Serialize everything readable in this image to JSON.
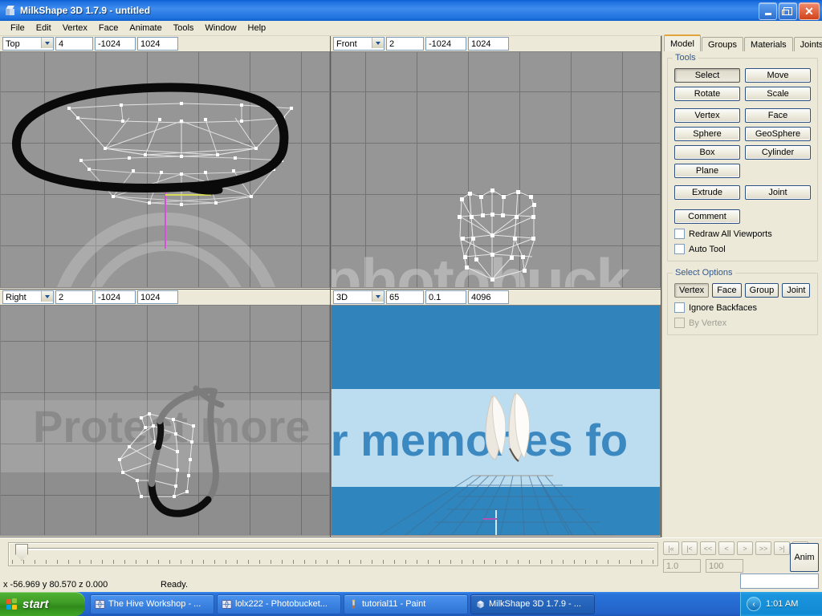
{
  "window": {
    "title": "MilkShape 3D 1.7.9 - untitled",
    "icon": "cube-icon",
    "controls": {
      "minimize": "_",
      "maximize": "□",
      "close": "✕"
    }
  },
  "menubar": {
    "items": [
      "File",
      "Edit",
      "Vertex",
      "Face",
      "Animate",
      "Tools",
      "Window",
      "Help"
    ]
  },
  "viewports": [
    {
      "name": "top",
      "mode": "Top",
      "f1": "4",
      "f2": "-1024",
      "f3": "1024"
    },
    {
      "name": "front",
      "mode": "Front",
      "f1": "2",
      "f2": "-1024",
      "f3": "1024"
    },
    {
      "name": "right",
      "mode": "Right",
      "f1": "2",
      "f2": "-1024",
      "f3": "1024"
    },
    {
      "name": "persp",
      "mode": "3D",
      "f1": "65",
      "f2": "0.1",
      "f3": "4096"
    }
  ],
  "right_panel": {
    "tabs": [
      {
        "label": "Model",
        "active": true
      },
      {
        "label": "Groups",
        "active": false
      },
      {
        "label": "Materials",
        "active": false
      },
      {
        "label": "Joints",
        "active": false
      }
    ],
    "tools": {
      "title": "Tools",
      "buttons": [
        "Select",
        "Move",
        "Rotate",
        "Scale",
        "Vertex",
        "Face",
        "Sphere",
        "GeoSphere",
        "Box",
        "Cylinder",
        "Plane",
        "Extrude",
        "Joint"
      ],
      "comment_label": "Comment",
      "checkboxes": [
        {
          "label": "Redraw All Viewports",
          "checked": false,
          "enabled": true
        },
        {
          "label": "Auto Tool",
          "checked": false,
          "enabled": true
        }
      ]
    },
    "select_options": {
      "title": "Select Options",
      "buttons": [
        {
          "label": "Vertex",
          "pressed": true
        },
        {
          "label": "Face",
          "pressed": false
        },
        {
          "label": "Group",
          "pressed": false
        },
        {
          "label": "Joint",
          "pressed": false
        }
      ],
      "checkboxes": [
        {
          "label": "Ignore Backfaces",
          "checked": false,
          "enabled": true
        },
        {
          "label": "By Vertex",
          "checked": false,
          "enabled": false
        }
      ]
    }
  },
  "bottom": {
    "status_coords": "x -56.969 y 80.570 z 0.000",
    "status_message": "Ready.",
    "anim_buttons": [
      "|«",
      "|<",
      "<<",
      "<",
      ">",
      ">>",
      ">|",
      ">||"
    ],
    "frame_current": "1.0",
    "frame_total": "100",
    "anim_toggle": "Anim",
    "anim_input_value": ""
  },
  "taskbar": {
    "start_label": "start",
    "tasks": [
      {
        "label": "The Hive Workshop - ...",
        "icon": "browser-icon",
        "active": false
      },
      {
        "label": "lolx222 - Photobucket...",
        "icon": "browser-icon",
        "active": false
      },
      {
        "label": "tutorial11 - Paint",
        "icon": "paint-icon",
        "active": false
      },
      {
        "label": "MilkShape 3D 1.7.9 - ...",
        "icon": "milkshape-icon",
        "active": true
      }
    ],
    "tray": {
      "chevron": "‹",
      "clock": "1:01 AM"
    }
  },
  "watermark": {
    "line1": "photobucket",
    "line2": "Protect more of your memories for less!"
  },
  "colors": {
    "title_blue": "#1c6fe0",
    "panel_bg": "#ece9d8",
    "viewport_gray": "#969696",
    "taskbar_blue": "#2a74da",
    "start_green": "#3e9c26",
    "accent_tab": "#e2a33c",
    "sky_blue": "#2f85bd"
  }
}
